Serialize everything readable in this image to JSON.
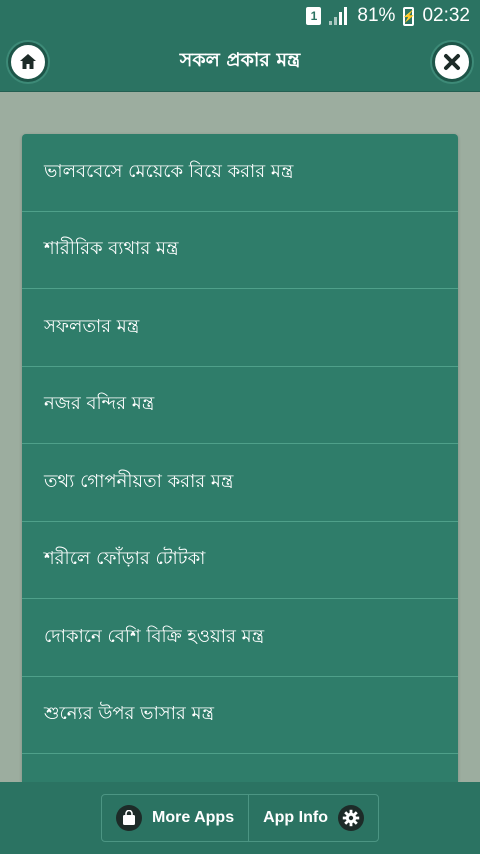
{
  "status_bar": {
    "sim_label": "1",
    "battery_percent": "81%",
    "time": "02:32"
  },
  "app_bar": {
    "title": "সকল প্রকার মন্ত্র",
    "home_icon": "home-icon",
    "close_icon": "close-icon"
  },
  "list": {
    "items": [
      {
        "label": "ভালববেসে মেয়েকে বিয়ে করার মন্ত্র"
      },
      {
        "label": "শারীরিক ব্যথার মন্ত্র"
      },
      {
        "label": "সফলতার মন্ত্র"
      },
      {
        "label": "নজর বন্দির মন্ত্র"
      },
      {
        "label": "তথ্য গোপনীয়তা করার মন্ত্র"
      },
      {
        "label": "শরীলে ফোঁড়ার টোটকা"
      },
      {
        "label": "দোকানে বেশি বিক্রি হওয়ার মন্ত্র"
      },
      {
        "label": "শুন্যের উপর ভাসার মন্ত্র"
      }
    ]
  },
  "bottom_bar": {
    "more_apps_label": "More Apps",
    "app_info_label": "App Info"
  },
  "colors": {
    "primary": "#2b7362",
    "card": "#2f7d6a",
    "background": "#9cad9f",
    "divider": "#4fa08a"
  }
}
